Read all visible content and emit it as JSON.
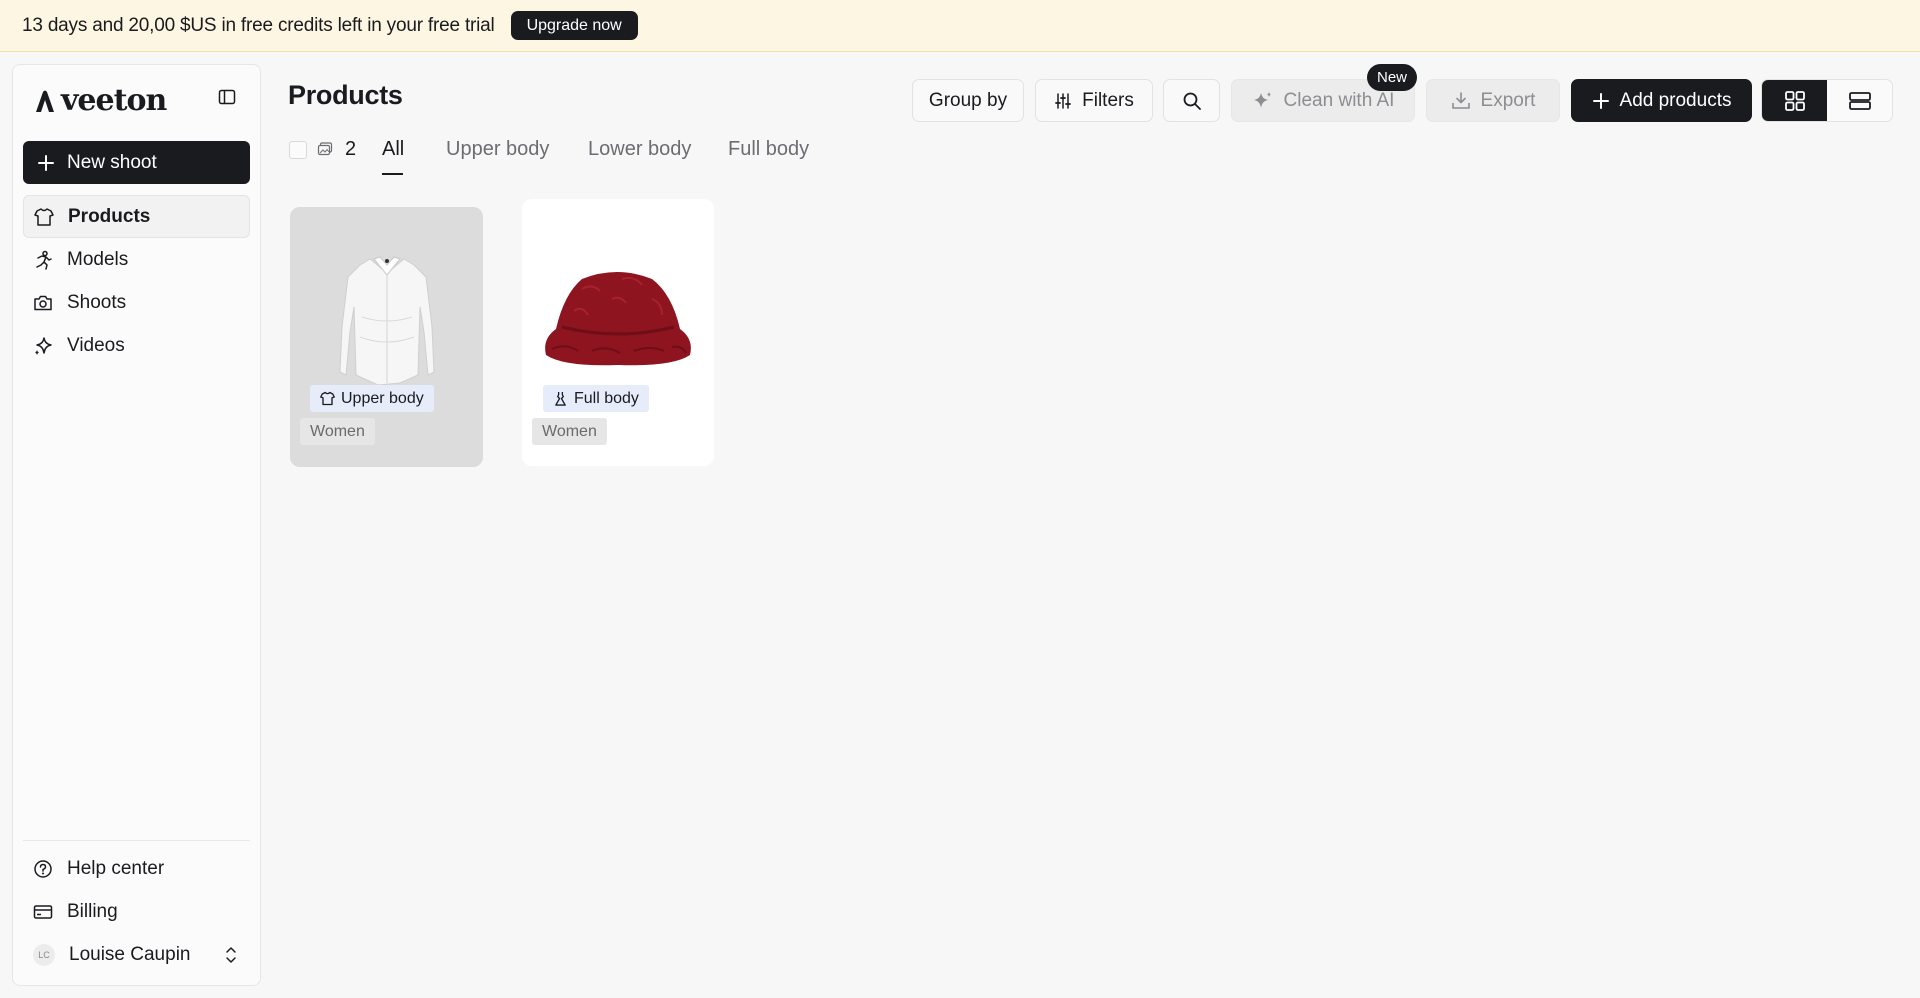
{
  "banner": {
    "text": "13 days and 20,00 $US in free credits left in your free trial",
    "upgrade_label": "Upgrade now"
  },
  "sidebar": {
    "logo_text": "veeton",
    "new_shoot_label": "New shoot",
    "items": [
      {
        "label": "Products",
        "icon": "shirt-icon",
        "active": true
      },
      {
        "label": "Models",
        "icon": "person-running-icon",
        "active": false
      },
      {
        "label": "Shoots",
        "icon": "camera-icon",
        "active": false
      },
      {
        "label": "Videos",
        "icon": "sparkle-icon",
        "active": false
      }
    ],
    "bottom": {
      "help_label": "Help center",
      "billing_label": "Billing",
      "user_initials": "LC",
      "user_name": "Louise Caupin"
    }
  },
  "header": {
    "title": "Products",
    "group_by_label": "Group by",
    "filters_label": "Filters",
    "clean_label": "Clean with AI",
    "clean_badge": "New",
    "export_label": "Export",
    "add_label": "Add products"
  },
  "tabs": {
    "count": "2",
    "items": [
      "All",
      "Upper body",
      "Lower body",
      "Full body"
    ],
    "active": "All"
  },
  "products": [
    {
      "category": "Upper body",
      "category_icon": "shirt-icon",
      "gender": "Women",
      "image": "white-shirt"
    },
    {
      "category": "Full body",
      "category_icon": "dress-icon",
      "gender": "Women",
      "image": "red-fur-bucket-hat"
    }
  ],
  "colors": {
    "accent_dark": "#1a1b1f",
    "banner_bg": "#fdf6e3",
    "category_chip": "#e7ecfb",
    "hat_red": "#8e1420"
  }
}
